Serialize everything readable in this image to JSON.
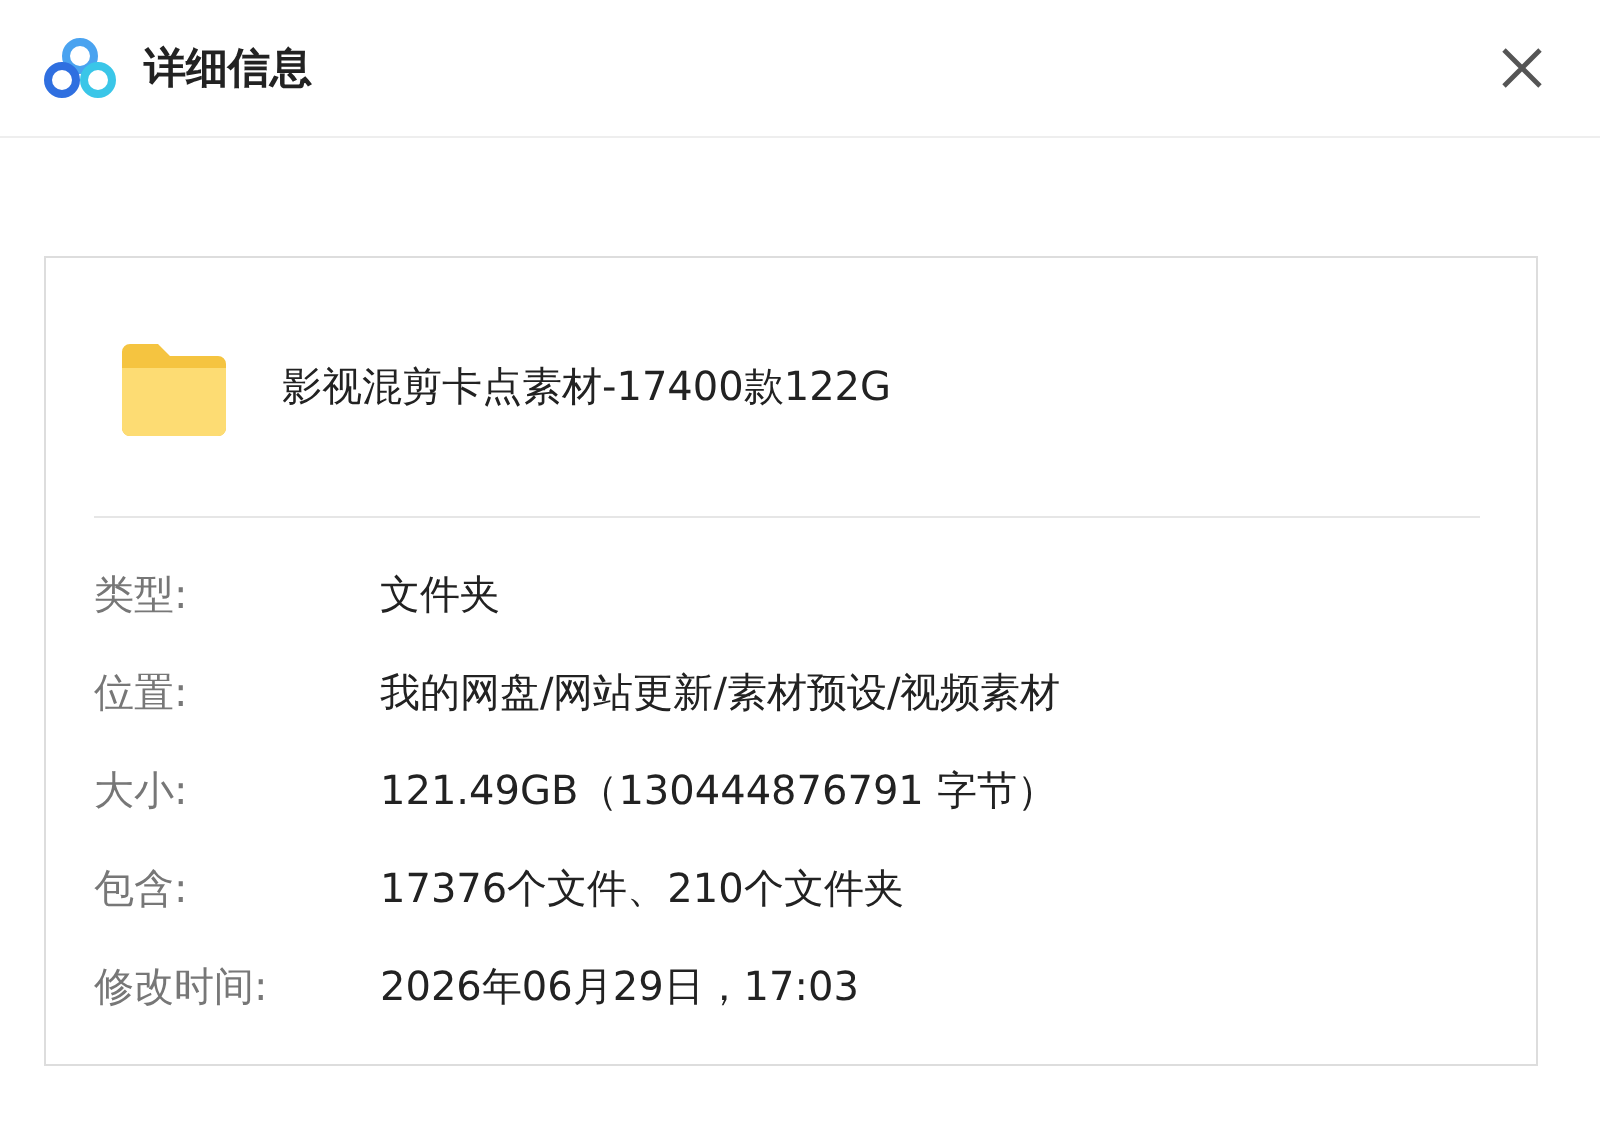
{
  "window": {
    "title": "详细信息"
  },
  "item": {
    "name": "影视混剪卡点素材-17400款122G"
  },
  "details": [
    {
      "label": "类型:",
      "value": "文件夹"
    },
    {
      "label": "位置:",
      "value": "我的网盘/网站更新/素材预设/视频素材"
    },
    {
      "label": "大小:",
      "value": "121.49GB（130444876791 字节）"
    },
    {
      "label": "包含:",
      "value": "17376个文件、210个文件夹"
    },
    {
      "label": "修改时间:",
      "value": "2026年06月29日，17:03"
    }
  ]
}
